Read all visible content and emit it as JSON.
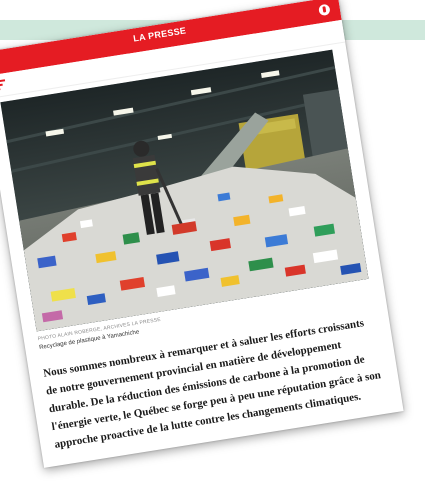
{
  "header": {
    "brand": "LA PRESSE"
  },
  "photo": {
    "credit": "PHOTO ALAIN ROBERGE, ARCHIVES LA PRESSE",
    "caption": "Recyclage de plastique à Yamachiche"
  },
  "article": {
    "lead": "Nous sommes nombreux à remarquer et à saluer les efforts croissants de notre gouvernement provincial en matière de développement durable. De la réduction des émissions de carbone à la promotion de l'énergie verte, le Québec se forge peu à peu une réputation grâce à son approche proactive de la lutte contre les changements climatiques."
  },
  "colors": {
    "brand_red": "#e51c23",
    "background_strip": "#cfe8dc"
  },
  "icons": {
    "menu": "menu-icon",
    "user": "user-icon"
  }
}
